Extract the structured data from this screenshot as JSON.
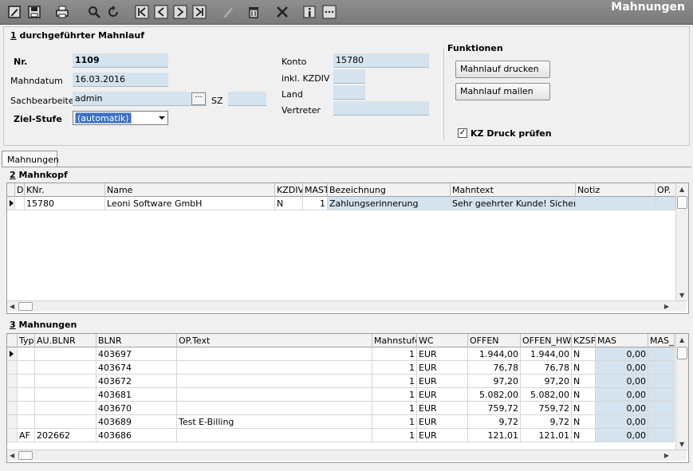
{
  "window": {
    "title": "Mahnungen"
  },
  "toolbar": {
    "buttons": [
      "edit-icon",
      "save-icon",
      "print-icon",
      "search-icon",
      "refresh-icon",
      "first-record-icon",
      "previous-record-icon",
      "next-record-icon",
      "last-record-icon",
      "disabled-edit-icon",
      "delete-icon",
      "cancel-icon",
      "info-icon",
      "more-icon"
    ]
  },
  "mahnlauf": {
    "group_num": "1",
    "group_title": " durchgeführter Mahnlauf",
    "nr_label": "Nr.",
    "nr_value": "1109",
    "mahndatum_label": "Mahndatum",
    "mahndatum_value": "16.03.2016",
    "sachbearbeiter_label": "Sachbearbeiter",
    "sachbearbeiter_value": "admin",
    "ellipsis_label": "···",
    "sz_label": "SZ",
    "sz_value": "",
    "zielstufe_label": "Ziel-Stufe",
    "zielstufe_value": "(automatik)",
    "konto_label": "Konto",
    "konto_value": "15780",
    "kzdiv_label": "inkl. KZDIV",
    "kzdiv_value": "",
    "land_label": "Land",
    "land_value": "",
    "vertreter_label": "Vertreter",
    "vertreter_value": ""
  },
  "funktionen": {
    "title": "Funktionen",
    "drucken_label": "Mahnlauf drucken",
    "mailen_label": "Mahnlauf mailen",
    "kz_druck_label": "KZ Druck prüfen",
    "kz_druck_checked": "✓"
  },
  "tabs": [
    {
      "label": "Mahnungen",
      "active": true
    }
  ],
  "mahnkopf": {
    "group_num": "2",
    "group_title": " Mahnkopf",
    "columns": [
      "D",
      "KNr.",
      "Name",
      "KZDIV",
      "MAST",
      "Bezeichnung",
      "Mahntext",
      "Notiz",
      "OP."
    ],
    "rows": [
      [
        "",
        "15780",
        "Leoni Software GmbH",
        "N",
        "1",
        "Zahlungserinnerung",
        "Sehr geehrter Kunde!  Sicher ist",
        "",
        ""
      ]
    ]
  },
  "mahnungen": {
    "group_num": "3",
    "group_title": " Mahnungen",
    "columns": [
      "Typ",
      "AU.BLNR",
      "BLNR",
      "OP.Text",
      "Mahnstufe",
      "WC",
      "OFFEN",
      "OFFEN_HW",
      "KZSP",
      "MAS",
      "MAS_H"
    ],
    "rows": [
      [
        "",
        "",
        "403697",
        "",
        "1",
        "EUR",
        "1.944,00",
        "1.944,00",
        "N",
        "0,00",
        ""
      ],
      [
        "",
        "",
        "403674",
        "",
        "1",
        "EUR",
        "76,78",
        "76,78",
        "N",
        "0,00",
        ""
      ],
      [
        "",
        "",
        "403672",
        "",
        "1",
        "EUR",
        "97,20",
        "97,20",
        "N",
        "0,00",
        ""
      ],
      [
        "",
        "",
        "403681",
        "",
        "1",
        "EUR",
        "5.082,00",
        "5.082,00",
        "N",
        "0,00",
        ""
      ],
      [
        "",
        "",
        "403670",
        "",
        "1",
        "EUR",
        "759,72",
        "759,72",
        "N",
        "0,00",
        ""
      ],
      [
        "",
        "",
        "403689",
        "Test E-Billing",
        "1",
        "EUR",
        "9,72",
        "9,72",
        "N",
        "0,00",
        ""
      ],
      [
        "AF",
        "202662",
        "403686",
        "",
        "1",
        "EUR",
        "121,01",
        "121,01",
        "N",
        "0,00",
        ""
      ]
    ]
  },
  "colors": {
    "toolbar_bg": "#858585",
    "field_bg": "#d5e3ee",
    "select_highlight": "#3a6fc9"
  }
}
